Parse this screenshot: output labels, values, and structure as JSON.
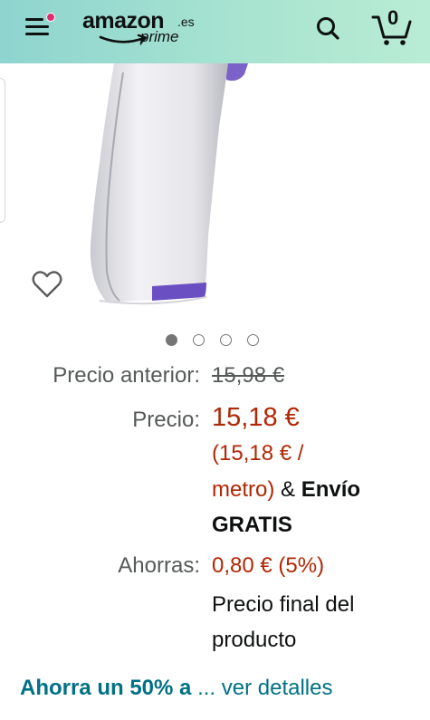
{
  "header": {
    "logo_text": "amazon",
    "logo_tld": ".es",
    "logo_sub": "prime",
    "cart_count": "0",
    "colors": {
      "header_bg_start": "#8ed4cf",
      "header_bg_end": "#b9ecd4",
      "notification_dot": "#e02d70"
    }
  },
  "carousel": {
    "total": 4,
    "active_index": 0
  },
  "pricing": {
    "old_label": "Precio anterior:",
    "old_value": "15,98 €",
    "price_label": "Precio:",
    "price_value": "15,18 €",
    "unit_line1": "(15,18 € /",
    "unit_line2": "metro)",
    "amp": " & ",
    "shipping_line1": "Envío",
    "shipping_line2": "GRATIS",
    "savings_label": "Ahorras:",
    "savings_value": "0,80 € (5%)",
    "final_line1": "Precio final del",
    "final_line2": "producto",
    "colors": {
      "price": "#b12704",
      "label": "#565959"
    }
  },
  "promo": {
    "bold_text": "Ahorra un 50% a",
    "link_text": "... ver detalles",
    "color": "#007185"
  }
}
